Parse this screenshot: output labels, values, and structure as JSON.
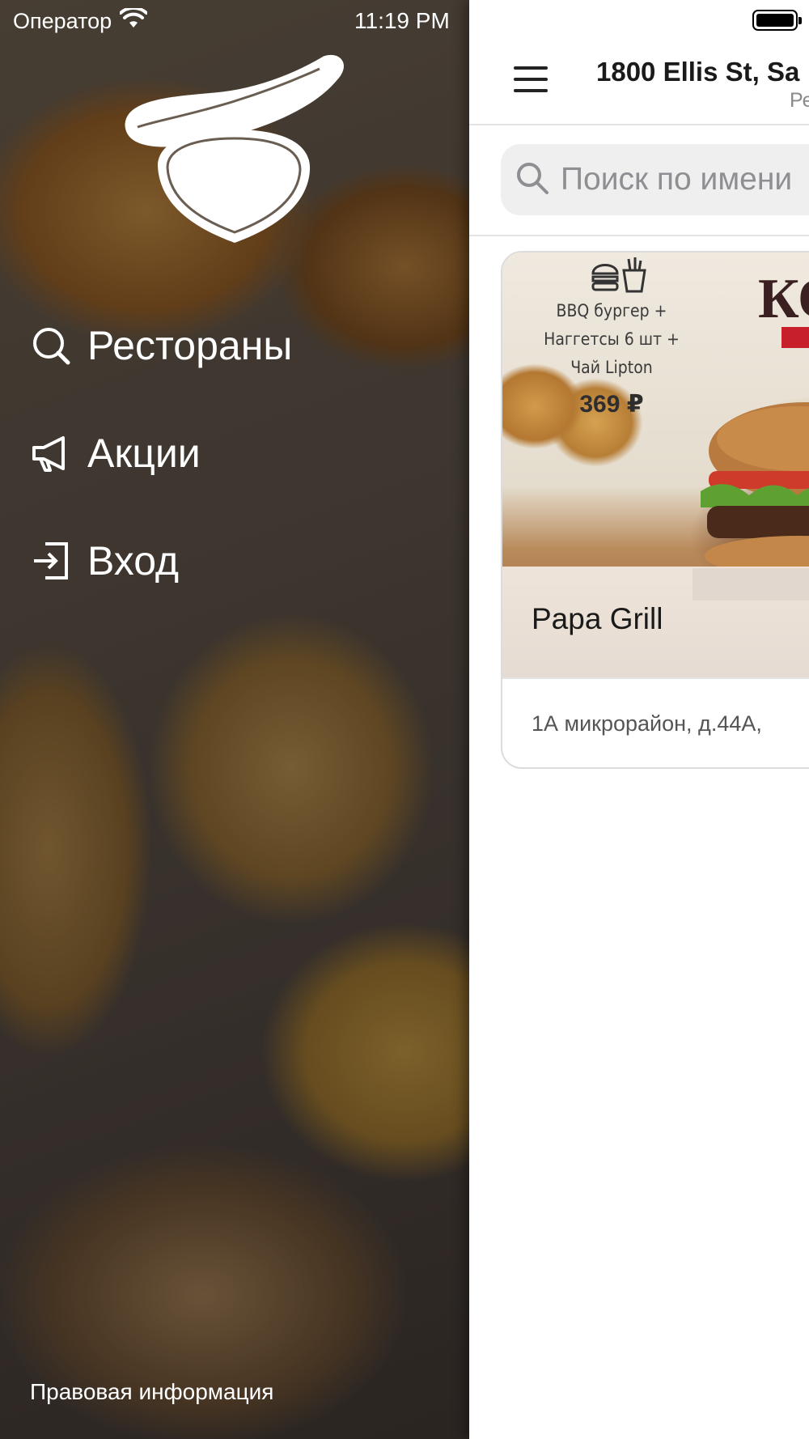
{
  "status_bar": {
    "carrier": "Оператор",
    "time": "11:19 PM"
  },
  "drawer": {
    "menu": [
      {
        "label": "Рестораны",
        "icon": "search-icon"
      },
      {
        "label": "Акции",
        "icon": "megaphone-icon"
      },
      {
        "label": "Вход",
        "icon": "login-icon"
      }
    ],
    "legal_link": "Правовая информация"
  },
  "header": {
    "address_title": "1800 Ellis St, Sa",
    "address_sub": "Ре"
  },
  "search": {
    "placeholder": "Поиск по имени"
  },
  "restaurant_card": {
    "promo_lines": [
      "BBQ бургер +",
      "Наггетсы 6 шт +",
      "Чай Lipton"
    ],
    "promo_price": "369 ₽",
    "promo_banner_text": "КО",
    "name": "Papa Grill",
    "address": "1А микрорайон, д.44А,"
  },
  "colors": {
    "accent_red": "#c8202a"
  }
}
